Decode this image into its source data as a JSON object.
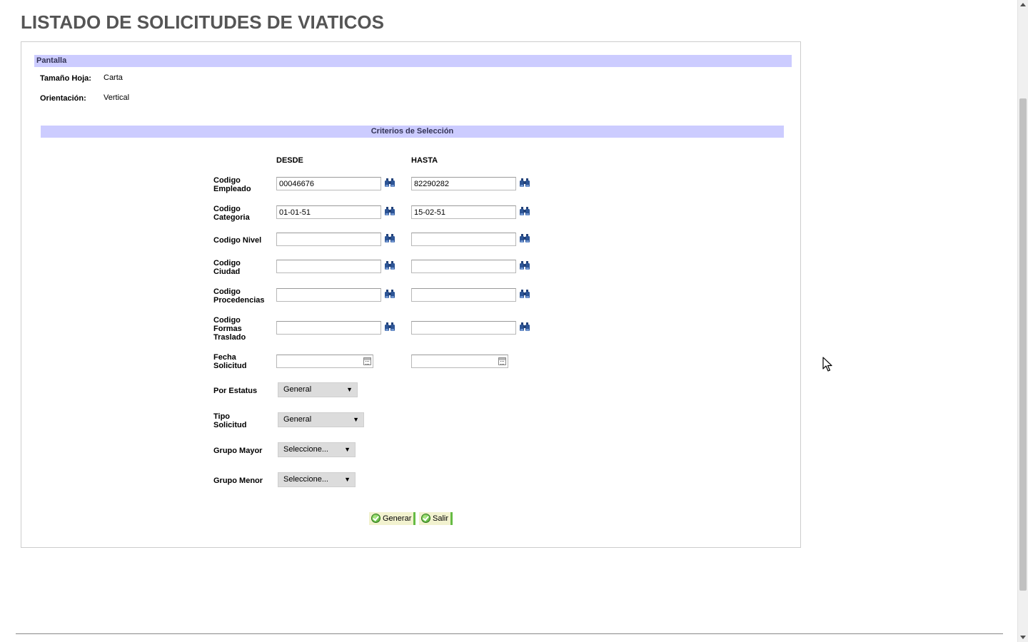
{
  "page": {
    "title": "LISTADO DE SOLICITUDES DE VIATICOS"
  },
  "pantalla": {
    "section_title": "Pantalla",
    "tamano_label": "Tamaño Hoja:",
    "tamano_value": "Carta",
    "orientacion_label": "Orientación:",
    "orientacion_value": "Vertical"
  },
  "criterios": {
    "section_title": "Criterios de Selección",
    "desde_header": "DESDE",
    "hasta_header": "HASTA",
    "rows": [
      {
        "label": "Codigo Empleado",
        "desde": "00046676",
        "hasta": "82290282"
      },
      {
        "label": "Codigo Categoria",
        "desde": "01-01-51",
        "hasta": "15-02-51"
      },
      {
        "label": "Codigo Nivel",
        "desde": "",
        "hasta": ""
      },
      {
        "label": "Codigo Ciudad",
        "desde": "",
        "hasta": ""
      },
      {
        "label": "Codigo Procedencias",
        "desde": "",
        "hasta": ""
      },
      {
        "label": "Codigo Formas Traslado",
        "desde": "",
        "hasta": ""
      }
    ],
    "fecha_label": "Fecha Solicitud",
    "fecha_desde": "",
    "fecha_hasta": "",
    "selects": [
      {
        "label": "Por Estatus",
        "value": "General"
      },
      {
        "label": "Tipo Solicitud",
        "value": "General"
      },
      {
        "label": "Grupo Mayor",
        "value": "Seleccione..."
      },
      {
        "label": "Grupo Menor",
        "value": "Seleccione..."
      }
    ]
  },
  "actions": {
    "generar_label": "Generar",
    "salir_label": "Salir"
  },
  "icons": {
    "lookup": "binoculars-icon",
    "calendar": "calendar-icon",
    "ok": "check-circle-icon",
    "dropdown": "triangle-down-icon"
  },
  "colors": {
    "section_bar": "#ccccff",
    "title": "#555555",
    "button_bg": "#f2f2cf",
    "button_accent": "#66bb44"
  }
}
